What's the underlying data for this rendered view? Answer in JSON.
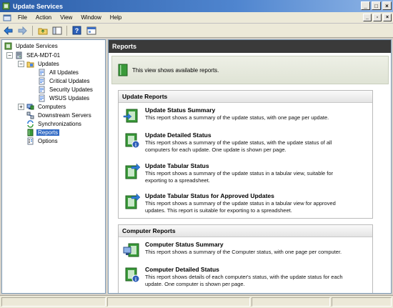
{
  "window": {
    "title": "Update Services",
    "controls": [
      "_",
      "□",
      "×"
    ]
  },
  "menu": {
    "items": [
      "File",
      "Action",
      "View",
      "Window",
      "Help"
    ],
    "mdi_controls": [
      "_",
      "▫",
      "×"
    ]
  },
  "tree": {
    "root": "Update Services",
    "server": "SEA-MDT-01",
    "updates": "Updates",
    "all_updates": "All Updates",
    "critical_updates": "Critical Updates",
    "security_updates": "Security Updates",
    "wsus_updates": "WSUS Updates",
    "computers": "Computers",
    "downstream_servers": "Downstream Servers",
    "synchronizations": "Synchronizations",
    "reports": "Reports",
    "options": "Options"
  },
  "main": {
    "header": "Reports",
    "info_text": "This view shows available reports.",
    "update_reports": {
      "heading": "Update Reports",
      "items": [
        {
          "title": "Update Status Summary",
          "desc1": "This report shows a summary of the update status, with one page per update.",
          "desc2": ""
        },
        {
          "title": "Update Detailed Status",
          "desc1": "This report shows a summary of the update status, with the update status of all",
          "desc2": "computers for each update. One update is shown per page."
        },
        {
          "title": "Update Tabular Status",
          "desc1": "This report shows a summary of the update status in a tabular view, suitable for",
          "desc2": "exporting to a spreadsheet."
        },
        {
          "title": "Update Tabular Status for Approved Updates",
          "desc1": "This report shows a summary of the update status in a tabular view for approved",
          "desc2": "updates. This report is suitable for exporting to a spreadsheet."
        }
      ]
    },
    "computer_reports": {
      "heading": "Computer Reports",
      "items": [
        {
          "title": "Computer Status Summary",
          "desc1": "This report shows a summary of the Computer status, with one page per computer.",
          "desc2": ""
        },
        {
          "title": "Computer Detailed Status",
          "desc1": "This report shows details of each computer's status, with the update status for each",
          "desc2": "update. One computer is shown per page."
        }
      ]
    }
  },
  "colors": {
    "selection": "#316ac5",
    "header_dark": "#3a3a3a",
    "book_green": "#3a9a3a"
  }
}
